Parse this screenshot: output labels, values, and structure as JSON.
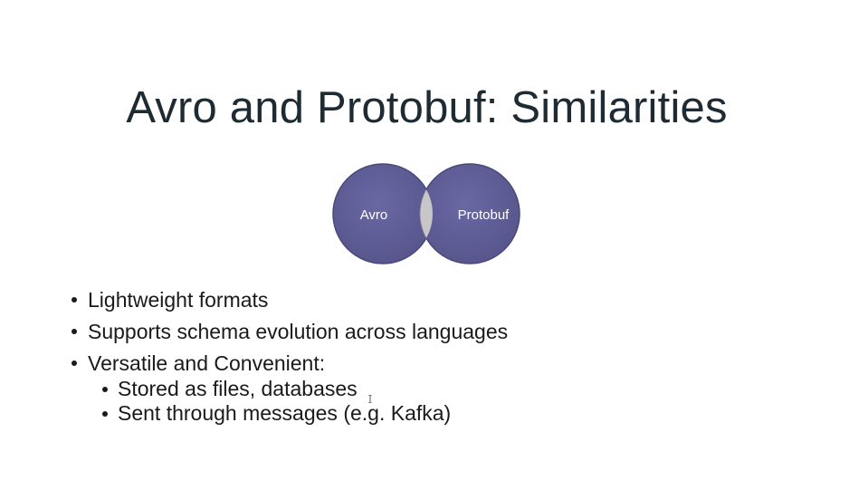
{
  "slide": {
    "title": "Avro and Protobuf: Similarities",
    "venn": {
      "left_label": "Avro",
      "right_label": "Protobuf",
      "circle_color": "#5d5b96",
      "overlap_color": "#c9c7c9"
    },
    "bullets": [
      {
        "text": "Lightweight formats"
      },
      {
        "text": "Supports schema evolution across languages"
      },
      {
        "text": "Versatile and Convenient:",
        "sub": [
          "Stored as files, databases",
          "Sent through messages (e.g. Kafka)"
        ]
      }
    ]
  }
}
